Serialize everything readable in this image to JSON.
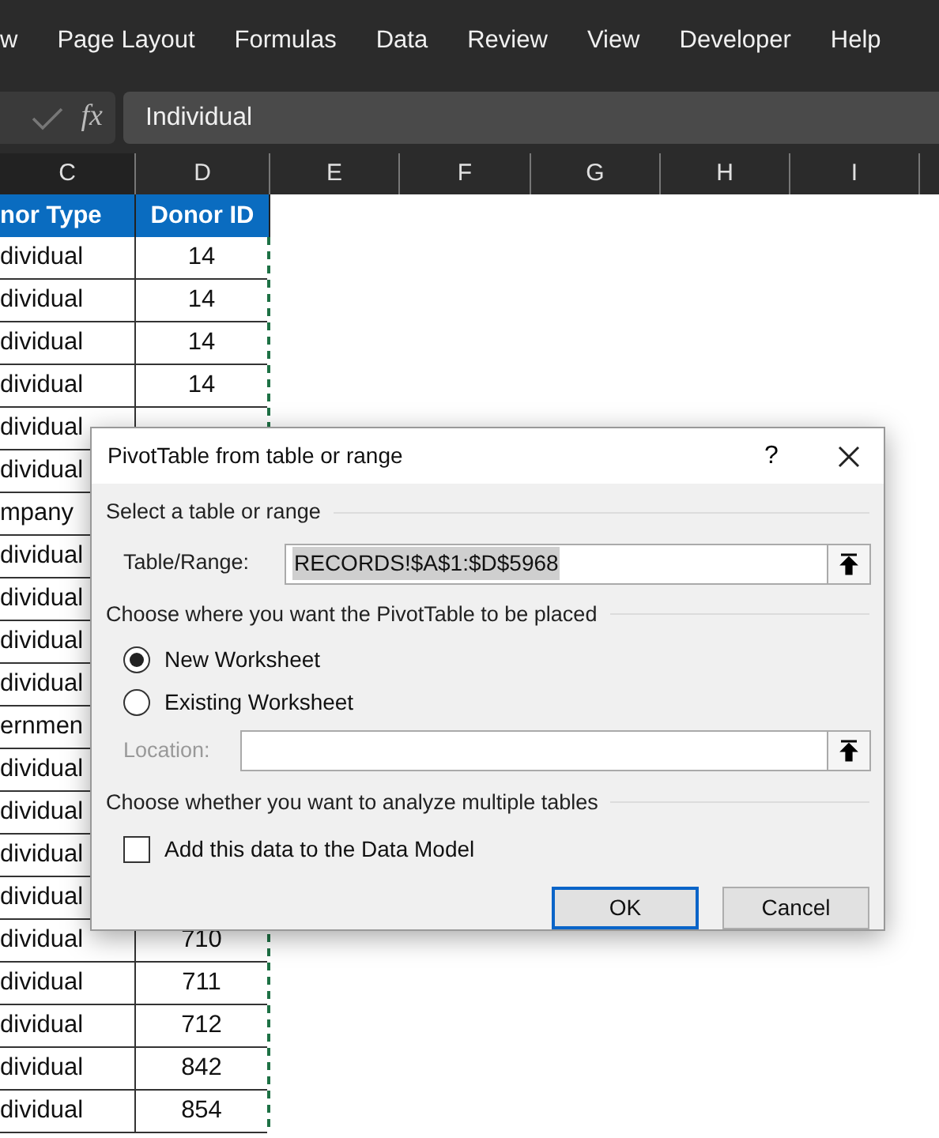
{
  "ribbon": {
    "tabs": [
      {
        "label": "w"
      },
      {
        "label": "Page Layout"
      },
      {
        "label": "Formulas"
      },
      {
        "label": "Data"
      },
      {
        "label": "Review"
      },
      {
        "label": "View"
      },
      {
        "label": "Developer"
      },
      {
        "label": "Help"
      }
    ]
  },
  "formula_bar": {
    "fx": "fx",
    "value": "Individual"
  },
  "columns": [
    "C",
    "D",
    "E",
    "F",
    "G",
    "H",
    "I"
  ],
  "table": {
    "header": [
      "nor Type",
      "Donor ID"
    ],
    "rows": [
      {
        "type": "dividual",
        "id": "14"
      },
      {
        "type": "dividual",
        "id": "14"
      },
      {
        "type": "dividual",
        "id": "14"
      },
      {
        "type": "dividual",
        "id": "14"
      },
      {
        "type": "dividual"
      },
      {
        "type": "dividual"
      },
      {
        "type": "mpany"
      },
      {
        "type": "dividual"
      },
      {
        "type": "dividual"
      },
      {
        "type": "dividual"
      },
      {
        "type": "dividual"
      },
      {
        "type": "ernmen"
      },
      {
        "type": "dividual"
      },
      {
        "type": "dividual"
      },
      {
        "type": "dividual"
      },
      {
        "type": "dividual"
      },
      {
        "type": "dividual",
        "id": "710"
      },
      {
        "type": "dividual",
        "id": "711"
      },
      {
        "type": "dividual",
        "id": "712"
      },
      {
        "type": "dividual",
        "id": "842"
      },
      {
        "type": "dividual",
        "id": "854"
      }
    ]
  },
  "dialog": {
    "title": "PivotTable from table or range",
    "help": "?",
    "section_1": "Select a table or range",
    "range": {
      "label": "Table/Range:",
      "value": "RECORDS!$A$1:$D$5968"
    },
    "section_2": "Choose where you want the PivotTable to be placed",
    "placement": [
      {
        "label": "New Worksheet",
        "selected": true
      },
      {
        "label": "Existing Worksheet",
        "selected": false
      }
    ],
    "location": {
      "label": "Location:",
      "disabled": true
    },
    "section_3": "Choose whether you want to analyze multiple tables",
    "data_model": {
      "label": "Add this data to the Data Model",
      "checked": false
    },
    "buttons": [
      {
        "label": "OK",
        "default": true
      },
      {
        "label": "Cancel",
        "default": false
      }
    ]
  }
}
